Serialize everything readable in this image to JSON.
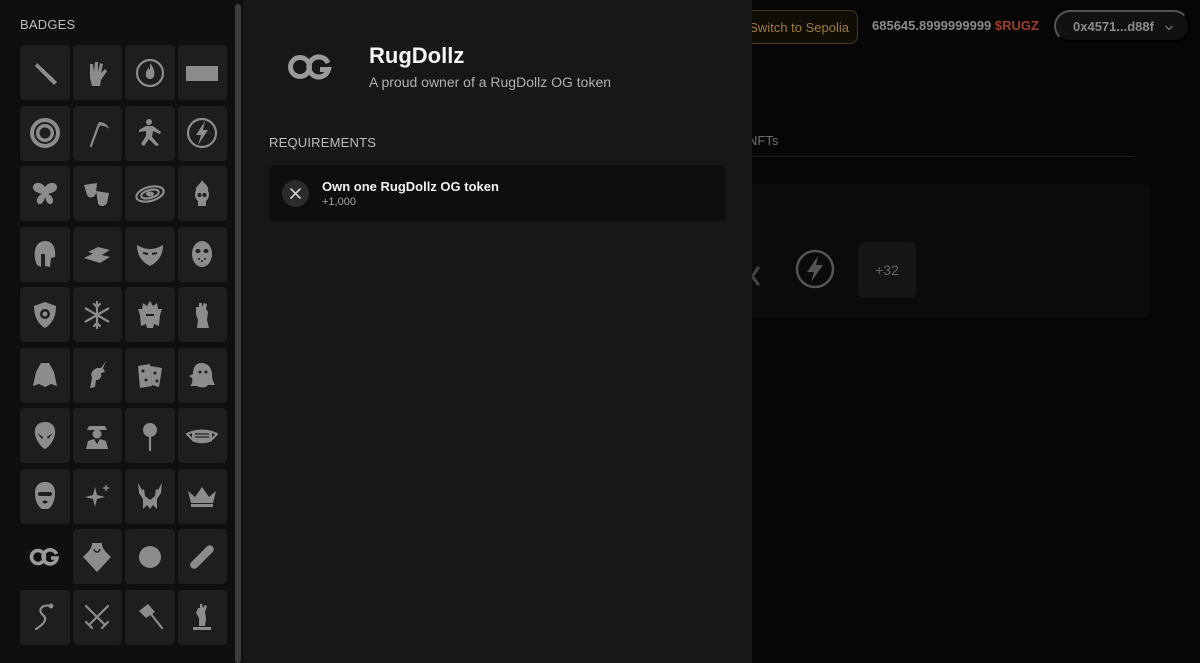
{
  "header": {
    "network_button": "Switch to Sepolia",
    "balance_amount": "685645.8999999999",
    "balance_symbol": "$RUGZ",
    "wallet_address": "0x4571...d88f"
  },
  "background": {
    "tab_fragment": "NFTs",
    "more_count": "+32"
  },
  "badges_panel": {
    "title": "BADGES",
    "badges": [
      "knife-icon",
      "glove-icon",
      "flame-circle-icon",
      "card-icon",
      "vortex-icon",
      "scythe-icon",
      "ninja-icon",
      "lightning-icon",
      "butterfly-icon",
      "theater-masks-icon",
      "galaxy-icon",
      "flaming-skull-icon",
      "spartan-helmet-icon",
      "gold-bars-icon",
      "viking-mask-icon",
      "hockey-mask-icon",
      "police-badge-icon",
      "snowflake-icon",
      "tribal-headdress-icon",
      "gauntlet-icon",
      "cape-icon",
      "unicorn-icon",
      "dice-icon",
      "ghost-icon",
      "alien-icon",
      "officer-icon",
      "lollipop-icon",
      "face-mask-icon",
      "balaclava-icon",
      "sparkles-icon",
      "viking-helmet-icon",
      "crown-icon",
      "og-icon",
      "bandana-icon",
      "circle-icon",
      "skateboard-icon",
      "snake-icon",
      "crossed-swords-icon",
      "hammer-icon",
      "zombie-hand-icon"
    ],
    "active_index": 32
  },
  "detail": {
    "title": "RugDollz",
    "description": "A proud owner of a RugDollz OG token",
    "requirements_heading": "REQUIREMENTS",
    "requirements": [
      {
        "label": "Own one RugDollz OG token",
        "points": "+1,000",
        "status": "unmet"
      }
    ]
  },
  "colors": {
    "panel_bg": "#0f0f0f",
    "detail_bg": "#171717",
    "badge_tile": "#1e1e1e",
    "icon_gray": "#8c8c8c",
    "token_accent": "#9c3f2a",
    "network_accent": "#a07a3b"
  }
}
